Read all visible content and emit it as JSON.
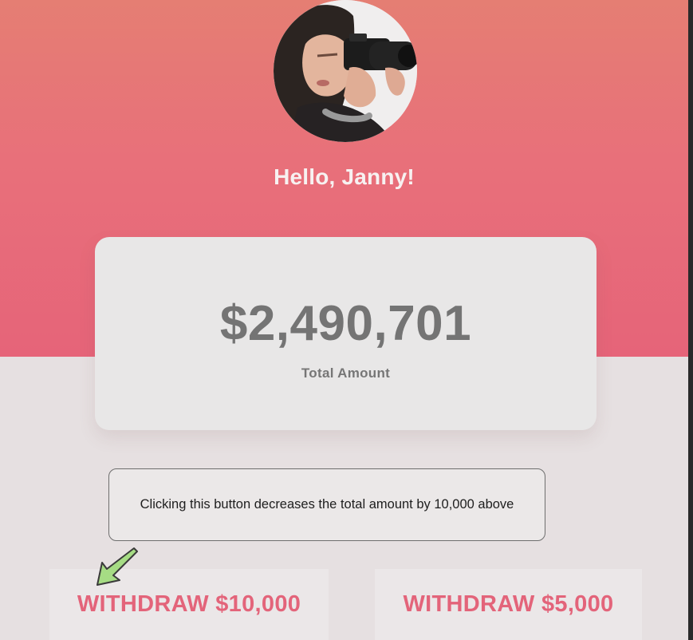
{
  "profile": {
    "greeting": "Hello, Janny!",
    "avatar_alt": "profile photo of a person with a camera"
  },
  "balance": {
    "amount": "$2,490,701",
    "label": "Total Amount"
  },
  "annotation": {
    "text": "Clicking this button decreases the total amount by 10,000 above",
    "pointer_icon": "arrow-pointer-icon",
    "pointer_color": "#a6dc84"
  },
  "actions": {
    "withdraw_10000": "WITHDRAW $10,000",
    "withdraw_5000": "WITHDRAW $5,000"
  },
  "colors": {
    "accent": "#e3647a",
    "hero_top": "#e57e73",
    "hero_bottom": "#e66479",
    "amount_text": "#747474"
  }
}
